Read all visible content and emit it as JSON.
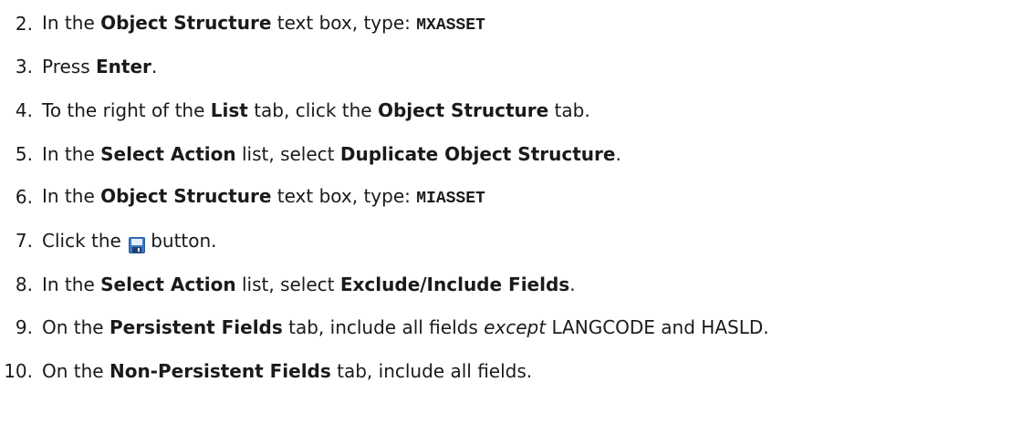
{
  "steps": [
    {
      "number": "2.",
      "parts": [
        {
          "text": "In the ",
          "style": "plain"
        },
        {
          "text": "Object Structure",
          "style": "bold"
        },
        {
          "text": " text box, type: ",
          "style": "plain"
        },
        {
          "text": "MXASSET",
          "style": "code"
        }
      ]
    },
    {
      "number": "3.",
      "parts": [
        {
          "text": "Press ",
          "style": "plain"
        },
        {
          "text": "Enter",
          "style": "bold"
        },
        {
          "text": ".",
          "style": "plain"
        }
      ]
    },
    {
      "number": "4.",
      "parts": [
        {
          "text": "To the right of the ",
          "style": "plain"
        },
        {
          "text": "List",
          "style": "bold"
        },
        {
          "text": " tab, click the ",
          "style": "plain"
        },
        {
          "text": "Object Structure",
          "style": "bold"
        },
        {
          "text": " tab.",
          "style": "plain"
        }
      ]
    },
    {
      "number": "5.",
      "parts": [
        {
          "text": "In the ",
          "style": "plain"
        },
        {
          "text": "Select Action",
          "style": "bold"
        },
        {
          "text": " list, select ",
          "style": "plain"
        },
        {
          "text": "Duplicate Object Structure",
          "style": "bold"
        },
        {
          "text": ".",
          "style": "plain"
        }
      ]
    },
    {
      "number": "6.",
      "parts": [
        {
          "text": "In the ",
          "style": "plain"
        },
        {
          "text": "Object Structure",
          "style": "bold"
        },
        {
          "text": " text box, type: ",
          "style": "plain"
        },
        {
          "text": "MIASSET",
          "style": "code"
        }
      ]
    },
    {
      "number": "7.",
      "parts": [
        {
          "text": "Click the ",
          "style": "plain"
        },
        {
          "icon": "save-icon"
        },
        {
          "text": "button.",
          "style": "plain"
        }
      ]
    },
    {
      "number": "8.",
      "parts": [
        {
          "text": "In the ",
          "style": "plain"
        },
        {
          "text": "Select Action",
          "style": "bold"
        },
        {
          "text": " list, select ",
          "style": "plain"
        },
        {
          "text": "Exclude/Include Fields",
          "style": "bold"
        },
        {
          "text": ".",
          "style": "plain"
        }
      ]
    },
    {
      "number": "9.",
      "parts": [
        {
          "text": "On the ",
          "style": "plain"
        },
        {
          "text": "Persistent Fields",
          "style": "bold"
        },
        {
          "text": " tab, include all fields ",
          "style": "plain"
        },
        {
          "text": "except",
          "style": "italic"
        },
        {
          "text": " LANGCODE and HASLD.",
          "style": "plain"
        }
      ]
    },
    {
      "number": "10.",
      "parts": [
        {
          "text": "On the ",
          "style": "plain"
        },
        {
          "text": "Non-Persistent Fields",
          "style": "bold"
        },
        {
          "text": " tab, include all fields.",
          "style": "plain"
        }
      ]
    }
  ],
  "colors": {
    "text": "#1a1a1a",
    "save_icon_body": "#3a78c8",
    "save_icon_label": "#e6eef8"
  }
}
